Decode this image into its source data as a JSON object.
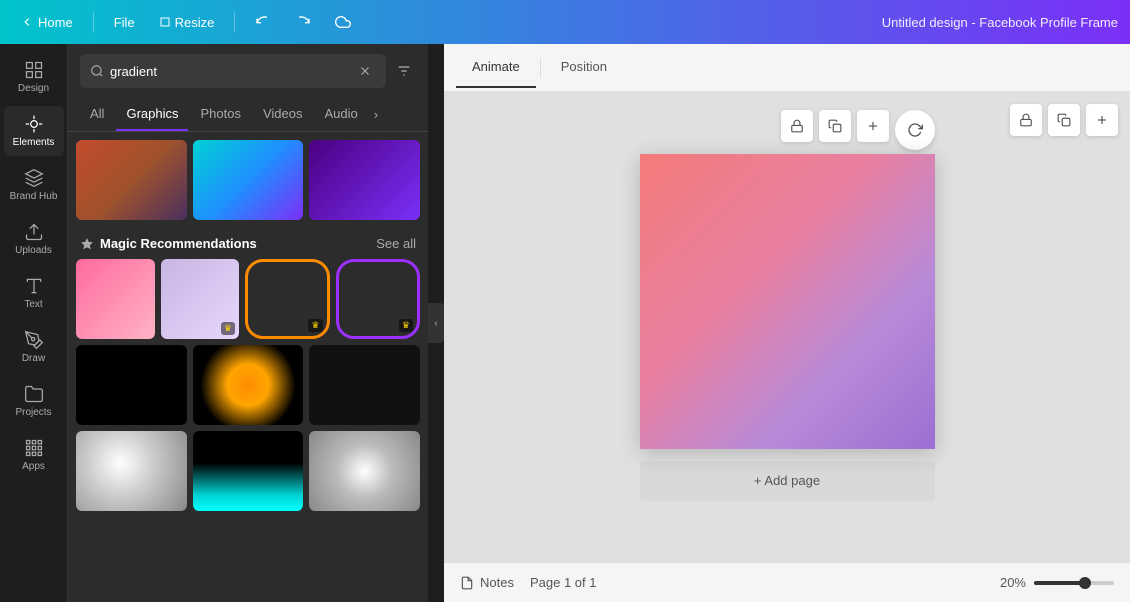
{
  "topbar": {
    "home_label": "Home",
    "file_label": "File",
    "resize_label": "Resize",
    "title": "Untitled design - Facebook Profile Frame"
  },
  "sidebar": {
    "items": [
      {
        "id": "design",
        "label": "Design"
      },
      {
        "id": "elements",
        "label": "Elements"
      },
      {
        "id": "brand-hub",
        "label": "Brand Hub"
      },
      {
        "id": "uploads",
        "label": "Uploads"
      },
      {
        "id": "text",
        "label": "Text"
      },
      {
        "id": "draw",
        "label": "Draw"
      },
      {
        "id": "projects",
        "label": "Projects"
      },
      {
        "id": "apps",
        "label": "Apps"
      }
    ]
  },
  "search": {
    "value": "gradient",
    "placeholder": "gradient"
  },
  "tabs": {
    "items": [
      {
        "id": "all",
        "label": "All"
      },
      {
        "id": "graphics",
        "label": "Graphics",
        "active": true
      },
      {
        "id": "photos",
        "label": "Photos"
      },
      {
        "id": "videos",
        "label": "Videos"
      },
      {
        "id": "audio",
        "label": "Audio"
      }
    ]
  },
  "magic_recommendations": {
    "title": "Magic Recommendations",
    "see_all": "See all"
  },
  "canvas": {
    "animate_label": "Animate",
    "position_label": "Position",
    "add_page_label": "+ Add page"
  },
  "bottom": {
    "notes_label": "Notes",
    "page_indicator": "Page 1 of 1",
    "zoom_level": "20%"
  }
}
